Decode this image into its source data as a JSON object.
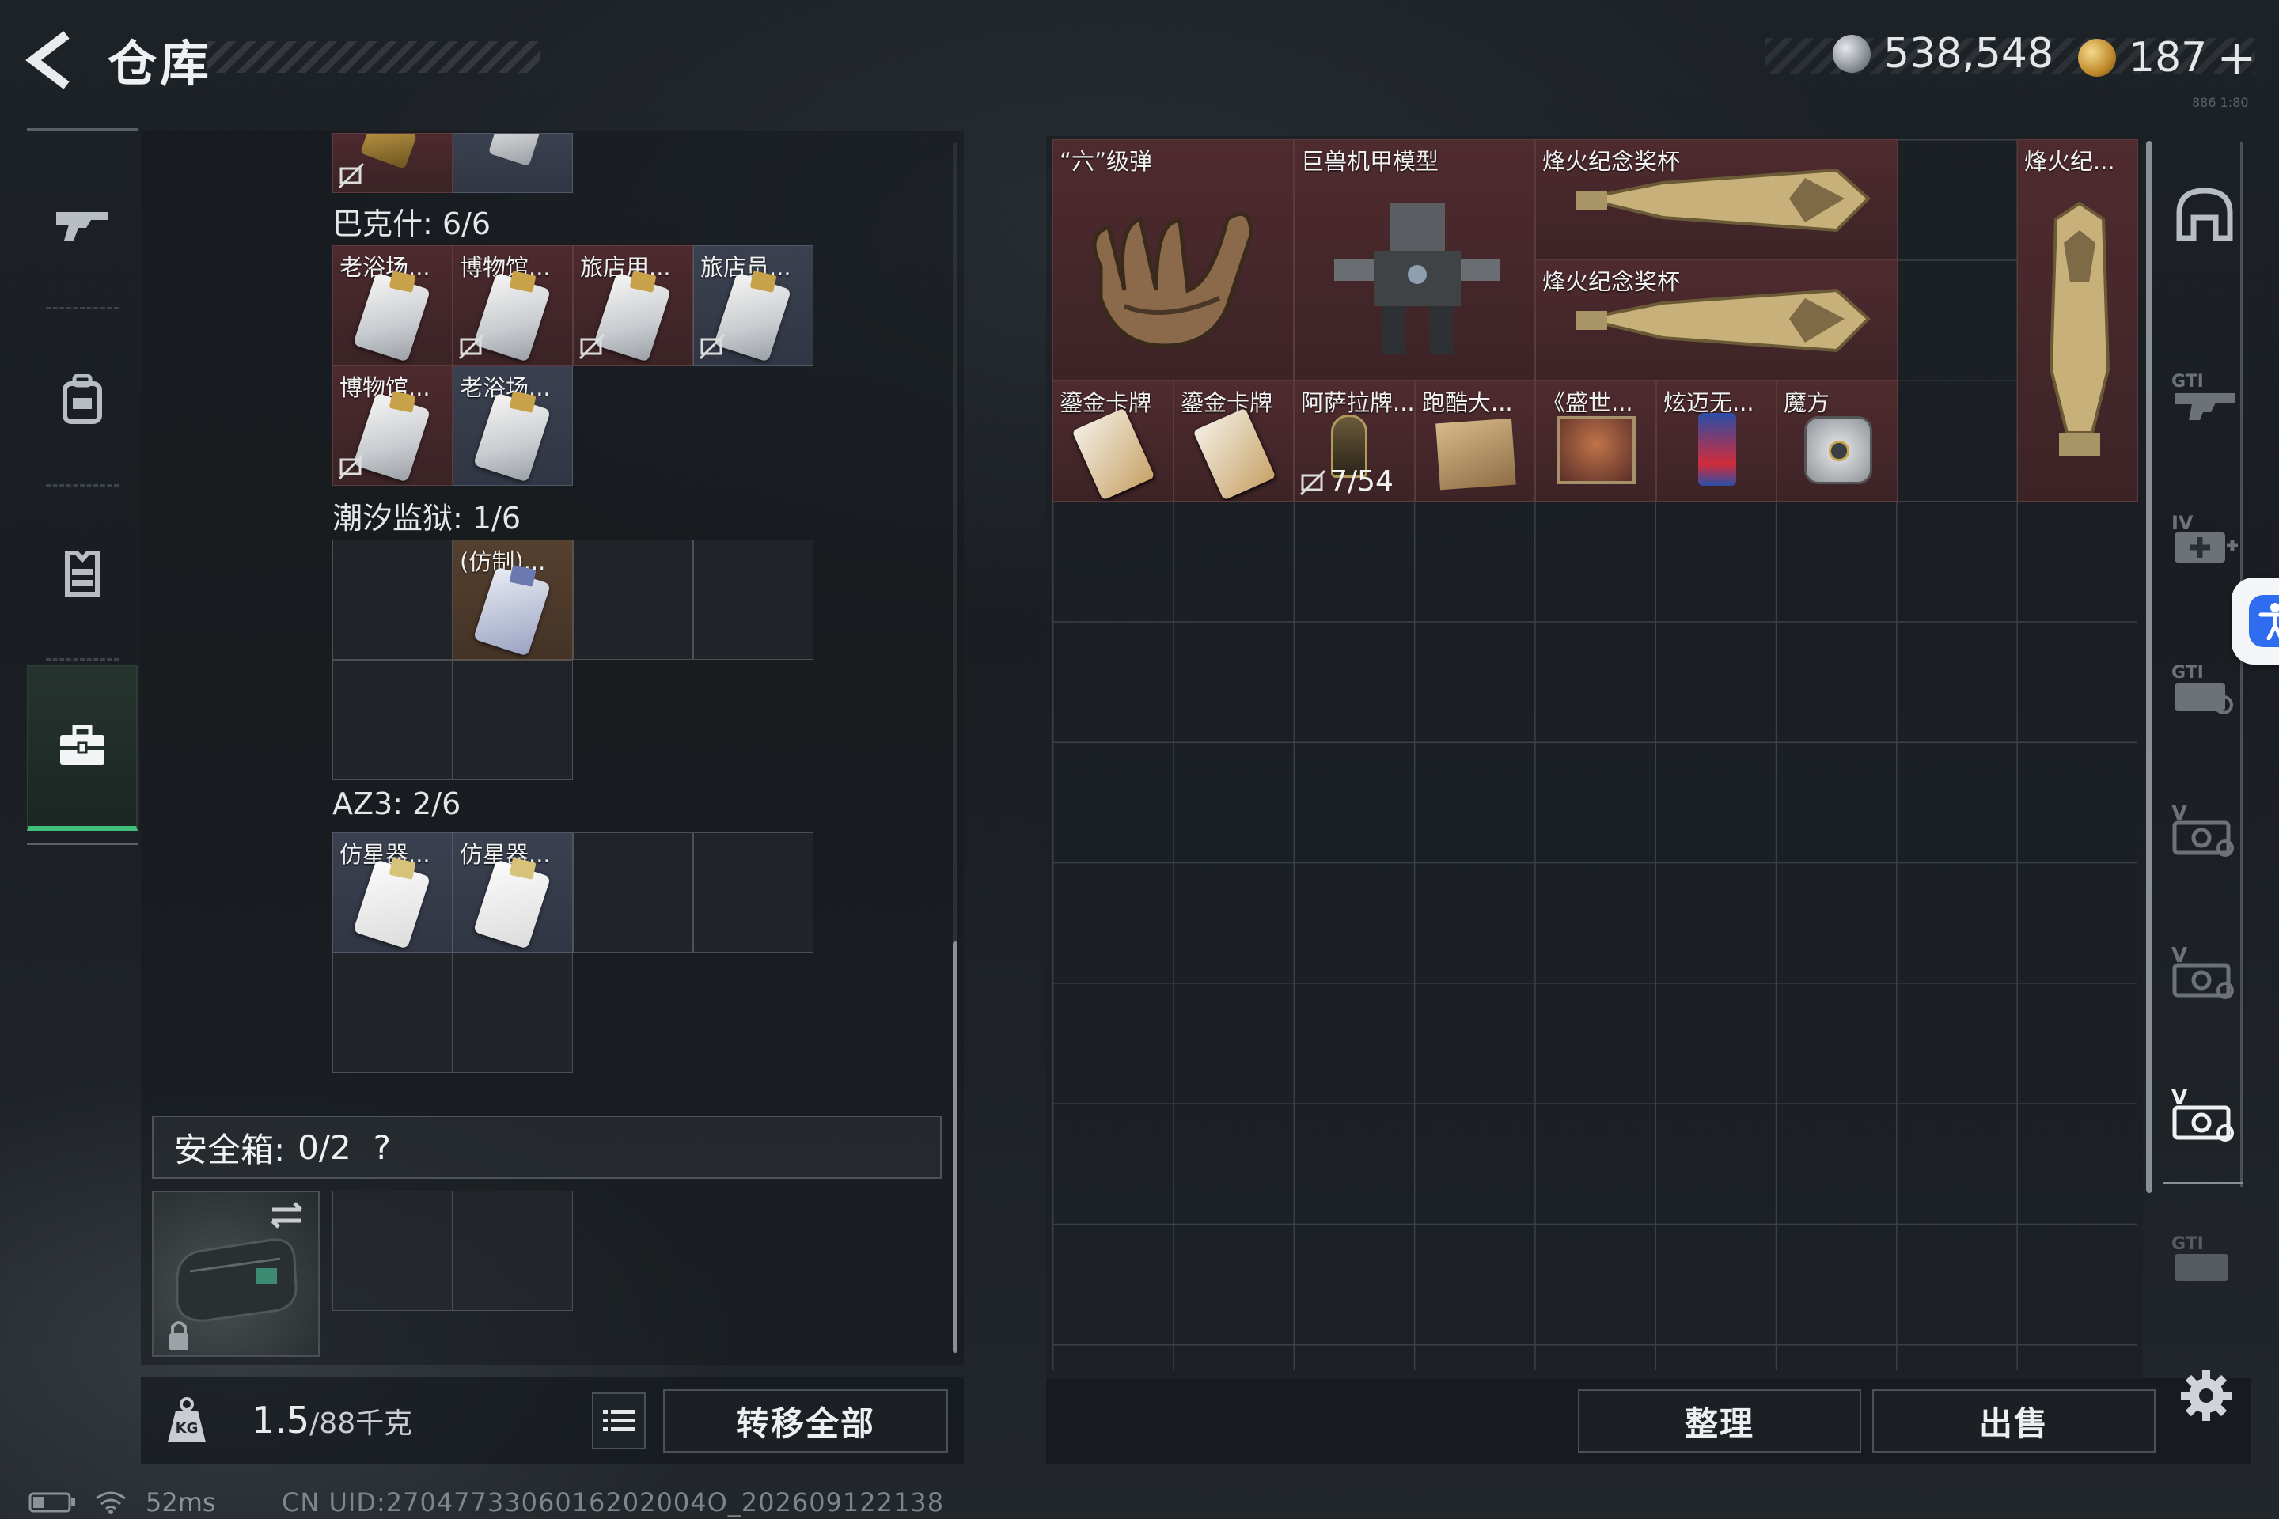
{
  "header": {
    "title": "仓库",
    "silver": "538,548",
    "gold": "187",
    "plus": "+",
    "corner_mark": "886 1:80"
  },
  "colors": {
    "accent_green": "#3fbf7a",
    "item_red": "#4f2b2f",
    "item_blue": "#3b4150",
    "item_orange": "#55402f",
    "accessibility_blue": "#2e6cf0"
  },
  "left_nav": [
    "rifle-icon",
    "backpack-icon",
    "vest-icon",
    "briefcase-icon"
  ],
  "left": {
    "sections": [
      {
        "title": "巴克什: 6/6",
        "items": [
          {
            "label": "老浴场...",
            "color": "red",
            "locked": false
          },
          {
            "label": "博物馆...",
            "color": "red",
            "locked": true
          },
          {
            "label": "旅店用...",
            "color": "red",
            "locked": true
          },
          {
            "label": "旅店员...",
            "color": "blue",
            "locked": true
          },
          {
            "label": "博物馆...",
            "color": "red",
            "locked": true
          },
          {
            "label": "老浴场...",
            "color": "blue",
            "locked": false
          }
        ]
      },
      {
        "title": "潮汐监狱: 1/6",
        "items": [
          {
            "label": "(仿制)...",
            "color": "orange",
            "locked": false
          }
        ]
      },
      {
        "title": "AZ3: 2/6",
        "items": [
          {
            "label": "仿星器...",
            "color": "blue",
            "locked": false
          },
          {
            "label": "仿星器...",
            "color": "blue",
            "locked": false
          }
        ]
      }
    ],
    "safebox": {
      "label": "安全箱:",
      "count": "0/2",
      "help": "?"
    },
    "weight": {
      "value": "1.5",
      "capacity": "/88千克"
    },
    "transfer_all": "转移全部"
  },
  "stash": {
    "items": [
      {
        "label": "“六”级弹",
        "icon": "hand-gesture-icon"
      },
      {
        "label": "巨兽机甲模型",
        "icon": "mech-model-icon"
      },
      {
        "label": "烽火纪念奖杯",
        "icon": "trophy-horizontal-icon"
      },
      {
        "label": "烽火纪念奖杯",
        "icon": "trophy-horizontal-icon"
      },
      {
        "label": "烽火纪...",
        "icon": "trophy-vertical-icon"
      },
      {
        "label": "鎏金卡牌",
        "icon": "gold-card-icon"
      },
      {
        "label": "鎏金卡牌",
        "icon": "gold-card-icon"
      },
      {
        "label": "阿萨拉牌...",
        "icon": "token-icon",
        "count": "7/54"
      },
      {
        "label": "跑酷大...",
        "icon": "parchment-icon"
      },
      {
        "label": "《盛世...",
        "icon": "painting-icon"
      },
      {
        "label": "炫迈无...",
        "icon": "gum-pack-icon"
      },
      {
        "label": "魔方",
        "icon": "cube-icon"
      }
    ],
    "sort": "整理",
    "sell": "出售"
  },
  "right_rail": [
    "helmet-icon",
    "gti-gun-icon",
    "iv-medkit-icon",
    "gti-gun2-icon",
    "v-case-icon",
    "v-case2-icon",
    "v-case-active-icon",
    "gti-case-icon"
  ],
  "status": {
    "ping": "52ms",
    "uid": "CN UID:2704773306016202004O_202609122138"
  }
}
